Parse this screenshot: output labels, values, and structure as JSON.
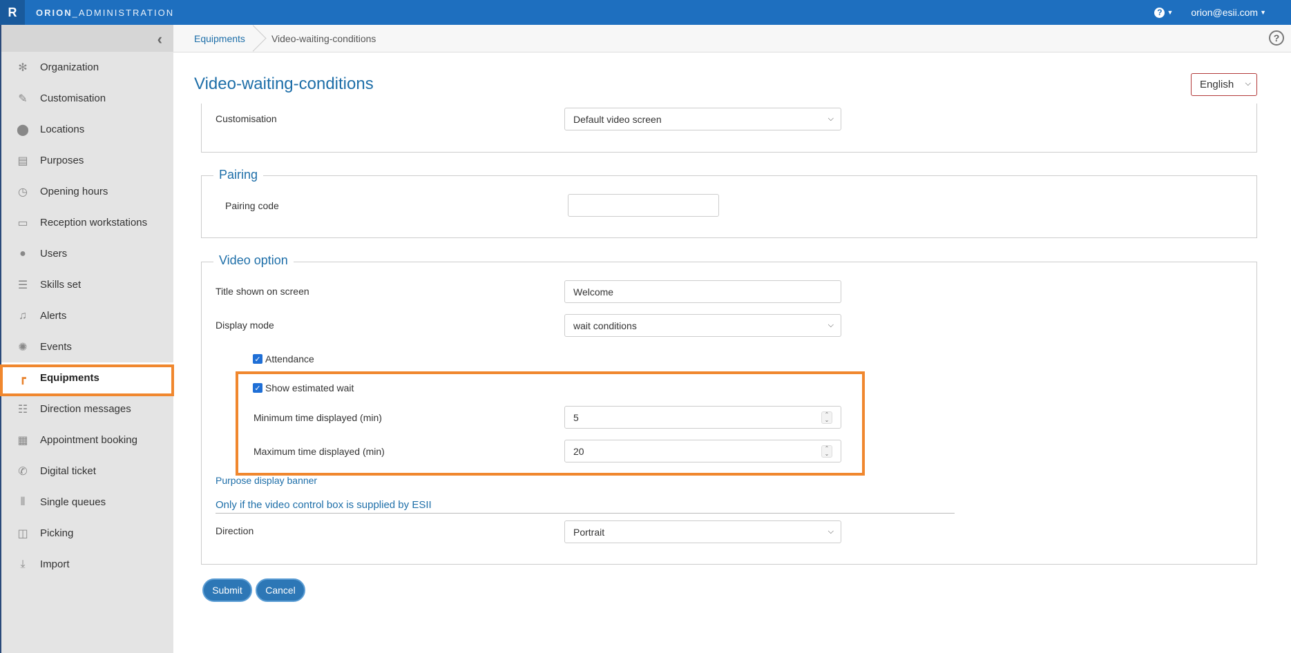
{
  "app": {
    "logo_letter": "R",
    "brand_prefix": "ORION",
    "brand_suffix": "_ADMINISTRATION",
    "user_email": "orion@esii.com"
  },
  "sidebar": {
    "items": [
      {
        "label": "Organization",
        "icon": "gear-icon"
      },
      {
        "label": "Customisation",
        "icon": "brush-icon"
      },
      {
        "label": "Locations",
        "icon": "map-pin-icon"
      },
      {
        "label": "Purposes",
        "icon": "clipboard-icon"
      },
      {
        "label": "Opening hours",
        "icon": "clock-icon"
      },
      {
        "label": "Reception workstations",
        "icon": "laptop-icon"
      },
      {
        "label": "Users",
        "icon": "user-icon"
      },
      {
        "label": "Skills set",
        "icon": "sliders-icon"
      },
      {
        "label": "Alerts",
        "icon": "bell-icon"
      },
      {
        "label": "Events",
        "icon": "gear-icon"
      },
      {
        "label": "Equipments",
        "icon": "kiosk-icon"
      },
      {
        "label": "Direction messages",
        "icon": "signpost-icon"
      },
      {
        "label": "Appointment booking",
        "icon": "calendar-icon"
      },
      {
        "label": "Digital ticket",
        "icon": "phone-icon"
      },
      {
        "label": "Single queues",
        "icon": "queue-icon"
      },
      {
        "label": "Picking",
        "icon": "box-icon"
      },
      {
        "label": "Import",
        "icon": "download-icon"
      }
    ]
  },
  "breadcrumb": {
    "parent": "Equipments",
    "current": "Video-waiting-conditions"
  },
  "page": {
    "title": "Video-waiting-conditions",
    "language": "English"
  },
  "customisation": {
    "label": "Customisation",
    "value": "Default video screen"
  },
  "pairing": {
    "legend": "Pairing",
    "code_label": "Pairing code",
    "code_value": ""
  },
  "video_option": {
    "legend": "Video option",
    "title_label": "Title shown on screen",
    "title_value": "Welcome",
    "display_mode_label": "Display mode",
    "display_mode_value": "wait conditions",
    "attendance_label": "Attendance",
    "attendance_checked": true,
    "show_wait_label": "Show estimated wait",
    "show_wait_checked": true,
    "min_label": "Minimum time displayed (min)",
    "min_value": "5",
    "max_label": "Maximum time displayed (min)",
    "max_value": "20",
    "purpose_banner_link": "Purpose display banner",
    "esii_note": "Only if the video control box is supplied by ESII",
    "direction_label": "Direction",
    "direction_value": "Portrait"
  },
  "actions": {
    "submit": "Submit",
    "cancel": "Cancel"
  },
  "colors": {
    "accent": "#1d6ea8",
    "topbar": "#1e6fbf",
    "highlight": "#f0872e"
  }
}
